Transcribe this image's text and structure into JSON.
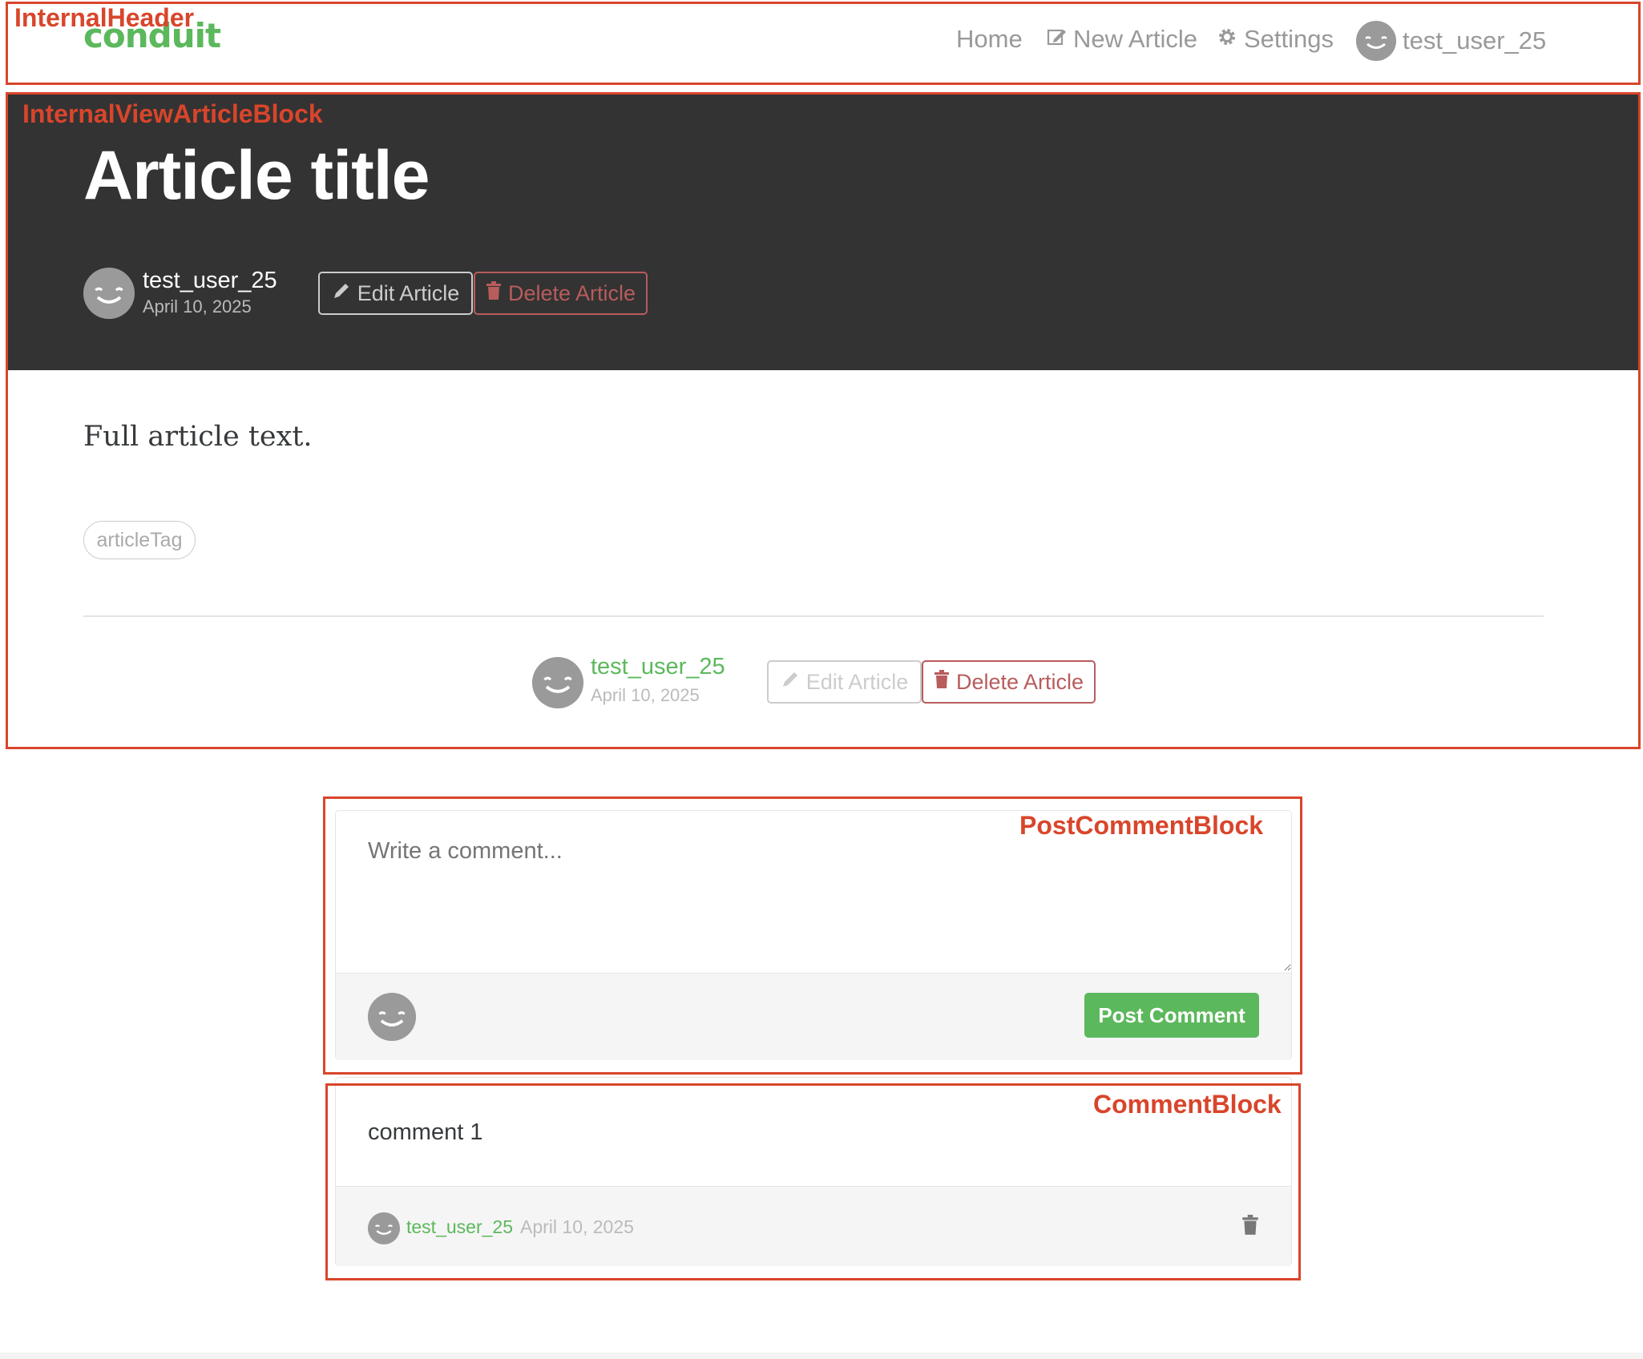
{
  "header": {
    "brand": "conduit",
    "nav": {
      "home": "Home",
      "new_article": "New Article",
      "settings": "Settings",
      "username": "test_user_25"
    }
  },
  "article": {
    "title": "Article title",
    "author": "test_user_25",
    "date": "April 10, 2025",
    "edit_label": "Edit Article",
    "delete_label": "Delete Article",
    "body": "Full article text.",
    "tags": [
      "articleTag"
    ]
  },
  "comment_form": {
    "placeholder": "Write a comment...",
    "submit_label": "Post Comment"
  },
  "comments": [
    {
      "body": "comment 1",
      "author": "test_user_25",
      "date": "April 10, 2025"
    }
  ],
  "annotations": {
    "header": "InternalHeader",
    "article_block": "InternalViewArticleBlock",
    "post_comment_block": "PostCommentBlock",
    "comment_block": "CommentBlock"
  },
  "colors": {
    "brand": "#5cb85c",
    "banner": "#333333",
    "danger": "#b85c5c",
    "annotation": "#d9452b"
  }
}
